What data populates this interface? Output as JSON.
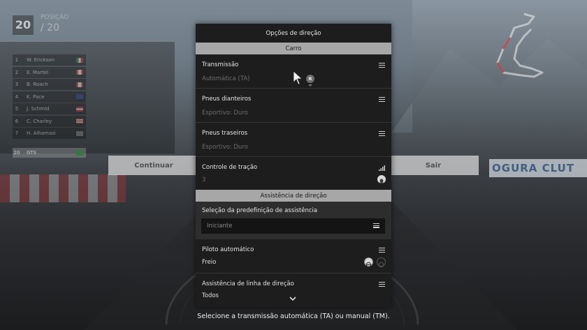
{
  "hud": {
    "position": "20",
    "position_label": "POSIÇÃO",
    "position_total": "/ 20",
    "standings": [
      {
        "pos": "1",
        "name": "W. Erickson",
        "flag": "mexico-flag"
      },
      {
        "pos": "2",
        "name": "E. Martel",
        "flag": "canada-flag"
      },
      {
        "pos": "3",
        "name": "B. Roach",
        "flag": "canada-flag"
      },
      {
        "pos": "4",
        "name": "K. Pace",
        "flag": "uk-flag"
      },
      {
        "pos": "5",
        "name": "J. Schmid",
        "flag": "austria-flag"
      },
      {
        "pos": "6",
        "name": "C. Charley",
        "flag": "usa-flag"
      },
      {
        "pos": "7",
        "name": "H. Alhamasi",
        "flag": "generic-flag"
      }
    ],
    "player": {
      "pos": "20",
      "name": "GTS"
    }
  },
  "background": {
    "banner_text": "OGURA CLUT",
    "continue_label": "Continuar",
    "exit_label": "Sair"
  },
  "panel": {
    "title": "Opções de direção",
    "section_car": "Carro",
    "section_assist": "Assistência de direção",
    "options": {
      "transmissao": {
        "label": "Transmissão",
        "value": "Automática (TA)"
      },
      "pneus_dianteiros": {
        "label": "Pneus dianteiros",
        "value": "Esportivo: Duro"
      },
      "pneus_traseiros": {
        "label": "Pneus traseiros",
        "value": "Esportivo: Duro"
      },
      "controle_tracao": {
        "label": "Controle de tração",
        "value": "3"
      },
      "preset": {
        "label": "Seleção da predefinição de assistência",
        "value": "Iniciante"
      },
      "piloto_automatico": {
        "label": "Piloto automático",
        "value": "Freio"
      },
      "linha_direcao": {
        "label": "Assistência de linha de direção",
        "value": "Todos"
      }
    }
  },
  "cursor_badge": "R",
  "hint": "Selecione a transmissão automática (TA) ou manual (TM).",
  "colors": {
    "panel_bg": "#1d1d1d",
    "section_header_bg": "#a7a7a7",
    "preset_block_bg": "#2d2d2d"
  }
}
